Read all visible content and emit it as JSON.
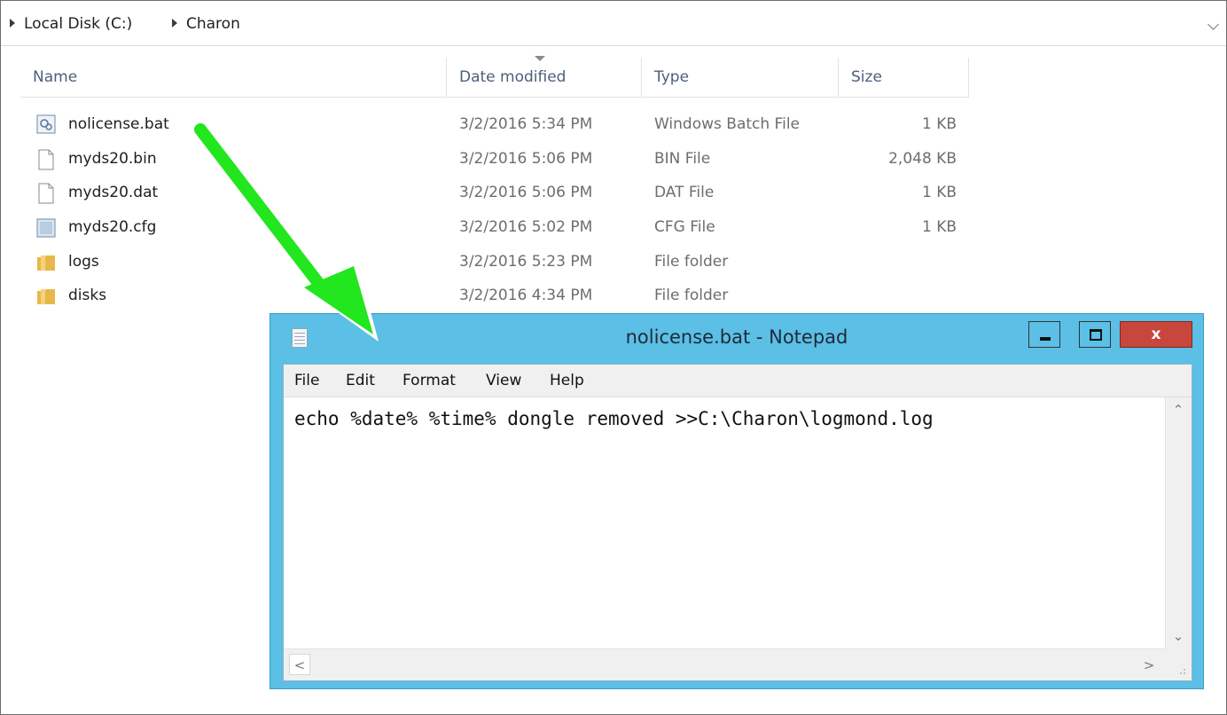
{
  "explorer": {
    "breadcrumb": [
      "Local Disk (C:)",
      "Charon"
    ],
    "columns": {
      "name": "Name",
      "date": "Date modified",
      "type": "Type",
      "size": "Size"
    },
    "files": [
      {
        "name": "nolicense.bat",
        "date": "3/2/2016 5:34 PM",
        "type": "Windows Batch File",
        "size": "1 KB",
        "icon": "batch-file-icon"
      },
      {
        "name": "myds20.bin",
        "date": "3/2/2016 5:06 PM",
        "type": "BIN File",
        "size": "2,048 KB",
        "icon": "file-icon"
      },
      {
        "name": "myds20.dat",
        "date": "3/2/2016 5:06 PM",
        "type": "DAT File",
        "size": "1 KB",
        "icon": "file-icon"
      },
      {
        "name": "myds20.cfg",
        "date": "3/2/2016 5:02 PM",
        "type": "CFG File",
        "size": "1 KB",
        "icon": "config-file-icon"
      },
      {
        "name": "logs",
        "date": "3/2/2016 5:23 PM",
        "type": "File folder",
        "size": "",
        "icon": "folder-icon"
      },
      {
        "name": "disks",
        "date": "3/2/2016 4:34 PM",
        "type": "File folder",
        "size": "",
        "icon": "folder-icon"
      }
    ]
  },
  "notepad": {
    "title": "nolicense.bat - Notepad",
    "close_label": "x",
    "menu": [
      "File",
      "Edit",
      "Format",
      "View",
      "Help"
    ],
    "content": "echo %date% %time% dongle removed >>C:\\Charon\\logmond.log"
  },
  "colors": {
    "annotation_arrow": "#22e61e",
    "notepad_frame": "#5bbfe6",
    "close_button": "#c8473c"
  }
}
